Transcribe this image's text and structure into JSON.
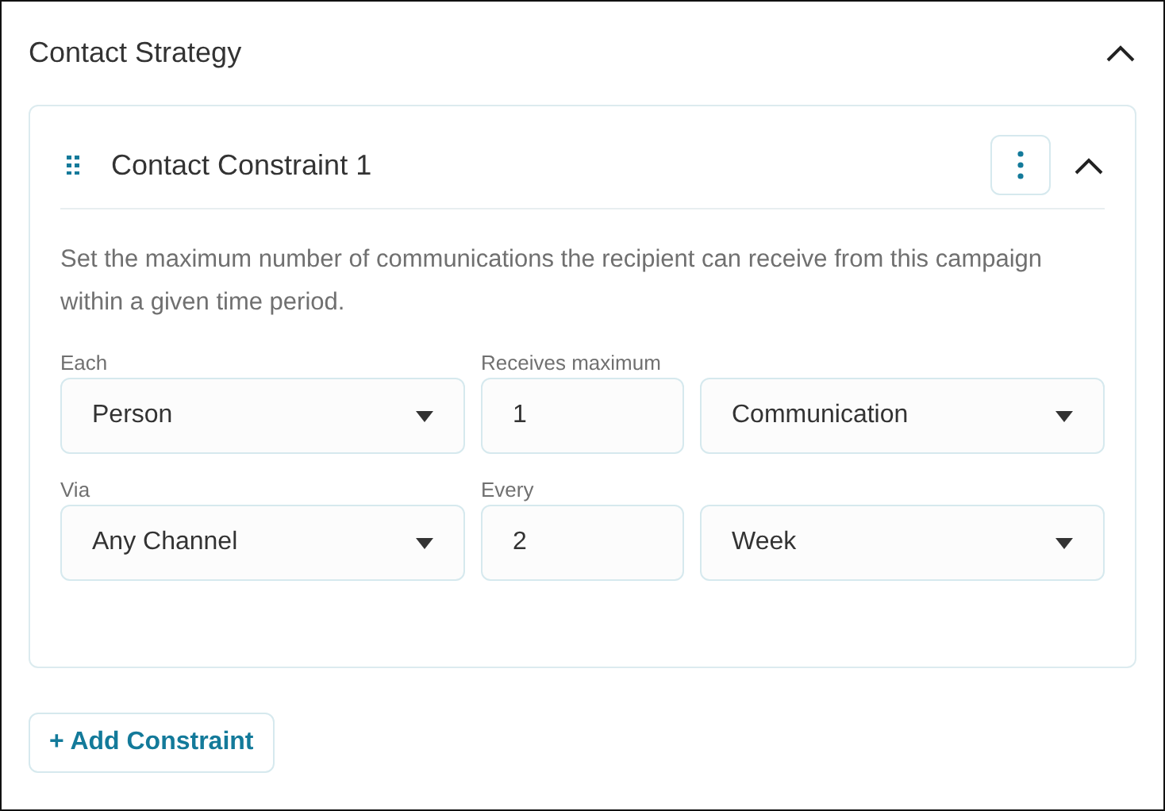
{
  "section": {
    "title": "Contact Strategy",
    "expanded": true
  },
  "constraints": [
    {
      "title": "Contact Constraint 1",
      "expanded": true,
      "description": "Set the maximum number of communications the recipient can receive from this campaign within a given time period.",
      "rows": [
        {
          "fields": [
            {
              "kind": "select",
              "label": "Each",
              "value": "Person"
            },
            {
              "kind": "number",
              "label": "Receives maximum",
              "value": "1"
            },
            {
              "kind": "select",
              "value": "Communication"
            }
          ]
        },
        {
          "fields": [
            {
              "kind": "select",
              "label": "Via",
              "value": "Any Channel"
            },
            {
              "kind": "number",
              "label": "Every",
              "value": "2"
            },
            {
              "kind": "select",
              "value": "Week"
            }
          ]
        }
      ]
    }
  ],
  "add_button": {
    "label": "+ Add Constraint"
  }
}
